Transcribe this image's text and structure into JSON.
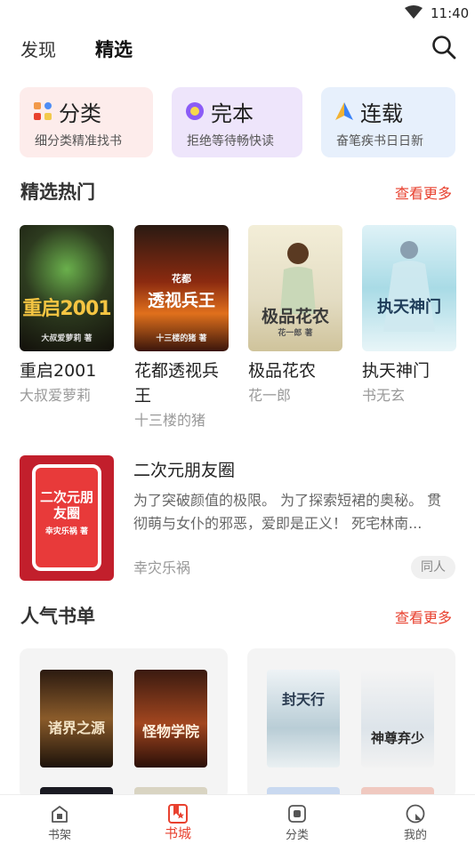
{
  "status": {
    "time": "11:40"
  },
  "top_nav": {
    "tabs": [
      "发现",
      "精选"
    ],
    "active": "精选"
  },
  "categories": [
    {
      "title": "分类",
      "subtitle": "细分类精准找书"
    },
    {
      "title": "完本",
      "subtitle": "拒绝等待畅快读"
    },
    {
      "title": "连载",
      "subtitle": "奋笔疾书日日新"
    }
  ],
  "hot": {
    "title": "精选热门",
    "more": "查看更多",
    "books": [
      {
        "title": "重启2001",
        "author": "大叔爱萝莉",
        "cover_text": "重启2001",
        "cover_sub": "大叔爱萝莉 著"
      },
      {
        "title": "花都透视兵王",
        "author": "十三楼的猪",
        "cover_text": "透视兵王",
        "cover_top": "花都",
        "cover_sub": "十三楼的猪 著"
      },
      {
        "title": "极品花农",
        "author": "花一郎",
        "cover_text": "极品花农",
        "cover_sub": "花一郎 著"
      },
      {
        "title": "执天神门",
        "author": "书无玄",
        "cover_text": "执天神门"
      }
    ]
  },
  "feature": {
    "title": "二次元朋友圈",
    "desc": "为了突破颜值的极限。 为了探索短裙的奥秘。 贯彻萌与女仆的邪恶，爱即是正义！ 死宅林南...",
    "author": "幸灾乐祸",
    "tag": "同人",
    "cover_text": "二次元朋友圈",
    "cover_sub": "幸灾乐祸 著"
  },
  "lists": {
    "title": "人气书单",
    "more": "查看更多",
    "card1": [
      {
        "cover_text": "诸界之源"
      },
      {
        "cover_text": "怪物学院"
      }
    ],
    "card2": [
      {
        "cover_text": "封天行"
      },
      {
        "cover_text": "神尊弃少"
      }
    ]
  },
  "bottom_nav": [
    {
      "label": "书架"
    },
    {
      "label": "书城"
    },
    {
      "label": "分类"
    },
    {
      "label": "我的"
    }
  ],
  "colors": {
    "accent": "#e8412f"
  }
}
